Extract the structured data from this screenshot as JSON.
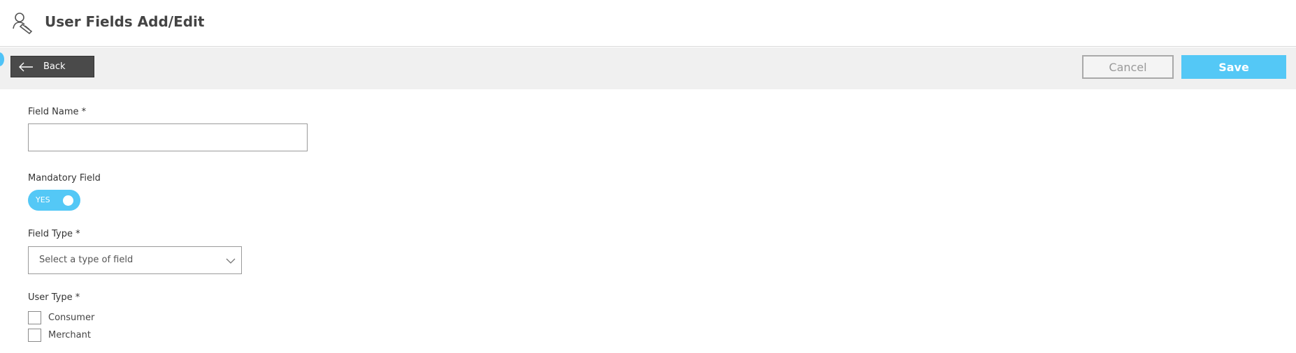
{
  "header": {
    "title": "User Fields Add/Edit",
    "icon": "user-fields-icon"
  },
  "toolbar": {
    "back_label": "Back",
    "cancel_label": "Cancel",
    "save_label": "Save",
    "accent_color": "#54c8f6"
  },
  "form": {
    "field_name": {
      "label": "Field Name *",
      "value": "",
      "placeholder": ""
    },
    "mandatory": {
      "label": "Mandatory Field",
      "toggle_text": "YES",
      "state": true
    },
    "field_type": {
      "label": "Field Type *",
      "placeholder": "Select a type of field"
    },
    "user_type": {
      "label": "User Type *",
      "options": [
        {
          "label": "Consumer",
          "checked": false
        },
        {
          "label": "Merchant",
          "checked": false
        }
      ]
    }
  }
}
